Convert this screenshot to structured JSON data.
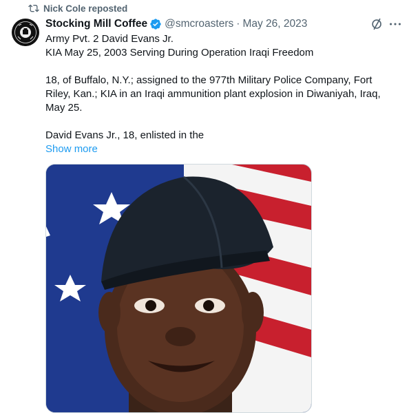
{
  "repost": {
    "label": "Nick Cole reposted",
    "icon": "repost-icon"
  },
  "author": {
    "display_name": "Stocking Mill Coffee",
    "handle": "@smcroasters",
    "separator": "·",
    "date": "May 26, 2023",
    "verified": true,
    "avatar_text_top": "STOCKING MILL",
    "avatar_text_bottom": "COFFEE"
  },
  "tweet": {
    "line1": "Army Pvt. 2 David Evans Jr.",
    "line2": "KIA May 25, 2003 Serving During Operation Iraqi Freedom",
    "para2": "18, of Buffalo, N.Y.; assigned to the 977th Military Police Company, Fort Riley, Kan.; KIA in an Iraqi ammunition plant explosion in Diwaniyah, Iraq, May 25.",
    "para3": "David Evans Jr., 18, enlisted in the",
    "show_more": "Show more"
  },
  "colors": {
    "accent": "#1d9bf0",
    "muted": "#536471",
    "text": "#0f1419",
    "border": "#cfd9de"
  },
  "icons": {
    "grok": "grok-icon",
    "more": "more-icon",
    "verified": "verified-badge-icon"
  }
}
